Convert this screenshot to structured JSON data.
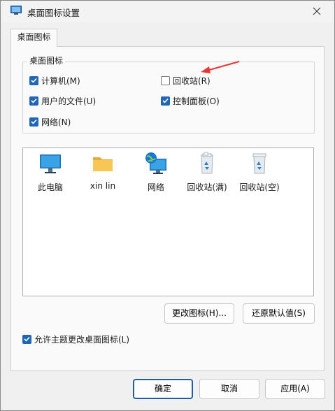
{
  "window": {
    "title": "桌面图标设置",
    "close_symbol": "×"
  },
  "tabs": [
    {
      "label": "桌面图标"
    }
  ],
  "group": {
    "legend": "桌面图标",
    "checkboxes": [
      {
        "label": "计算机(M)",
        "checked": true
      },
      {
        "label": "回收站(R)",
        "checked": false
      },
      {
        "label": "用户的文件(U)",
        "checked": true
      },
      {
        "label": "控制面板(O)",
        "checked": true
      },
      {
        "label": "网络(N)",
        "checked": true
      }
    ]
  },
  "icon_list": [
    {
      "name": "此电脑",
      "icon": "monitor-icon"
    },
    {
      "name": "xin lin",
      "icon": "folder-icon"
    },
    {
      "name": "网络",
      "icon": "network-globe-icon"
    },
    {
      "name": "回收站(满)",
      "icon": "recycle-bin-full-icon"
    },
    {
      "name": "回收站(空)",
      "icon": "recycle-bin-empty-icon"
    }
  ],
  "buttons": {
    "change_icon": "更改图标(H)...",
    "restore_default": "还原默认值(S)",
    "ok": "确定",
    "cancel": "取消",
    "apply": "应用(A)"
  },
  "allow_theme": {
    "label": "允许主题更改桌面图标(L)",
    "checked": true
  },
  "colors": {
    "accent": "#2166b5",
    "annotation_arrow": "#e53935"
  }
}
